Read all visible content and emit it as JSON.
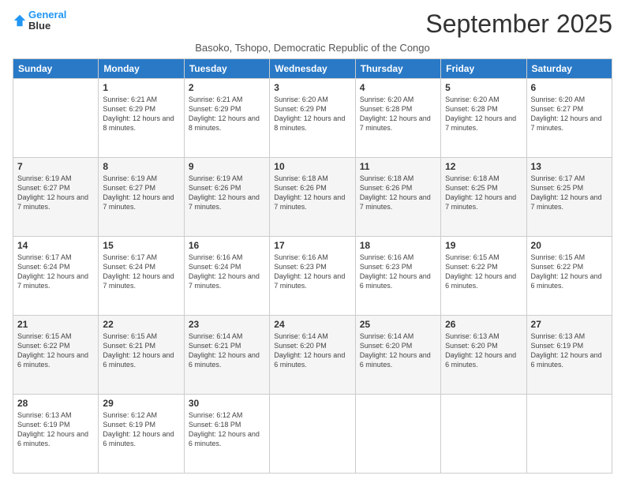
{
  "logo": {
    "line1": "General",
    "line2": "Blue"
  },
  "title": "September 2025",
  "subtitle": "Basoko, Tshopo, Democratic Republic of the Congo",
  "days_of_week": [
    "Sunday",
    "Monday",
    "Tuesday",
    "Wednesday",
    "Thursday",
    "Friday",
    "Saturday"
  ],
  "weeks": [
    [
      {
        "day": "",
        "info": ""
      },
      {
        "day": "1",
        "info": "Sunrise: 6:21 AM\nSunset: 6:29 PM\nDaylight: 12 hours\nand 8 minutes."
      },
      {
        "day": "2",
        "info": "Sunrise: 6:21 AM\nSunset: 6:29 PM\nDaylight: 12 hours\nand 8 minutes."
      },
      {
        "day": "3",
        "info": "Sunrise: 6:20 AM\nSunset: 6:29 PM\nDaylight: 12 hours\nand 8 minutes."
      },
      {
        "day": "4",
        "info": "Sunrise: 6:20 AM\nSunset: 6:28 PM\nDaylight: 12 hours\nand 7 minutes."
      },
      {
        "day": "5",
        "info": "Sunrise: 6:20 AM\nSunset: 6:28 PM\nDaylight: 12 hours\nand 7 minutes."
      },
      {
        "day": "6",
        "info": "Sunrise: 6:20 AM\nSunset: 6:27 PM\nDaylight: 12 hours\nand 7 minutes."
      }
    ],
    [
      {
        "day": "7",
        "info": "Sunrise: 6:19 AM\nSunset: 6:27 PM\nDaylight: 12 hours\nand 7 minutes."
      },
      {
        "day": "8",
        "info": "Sunrise: 6:19 AM\nSunset: 6:27 PM\nDaylight: 12 hours\nand 7 minutes."
      },
      {
        "day": "9",
        "info": "Sunrise: 6:19 AM\nSunset: 6:26 PM\nDaylight: 12 hours\nand 7 minutes."
      },
      {
        "day": "10",
        "info": "Sunrise: 6:18 AM\nSunset: 6:26 PM\nDaylight: 12 hours\nand 7 minutes."
      },
      {
        "day": "11",
        "info": "Sunrise: 6:18 AM\nSunset: 6:26 PM\nDaylight: 12 hours\nand 7 minutes."
      },
      {
        "day": "12",
        "info": "Sunrise: 6:18 AM\nSunset: 6:25 PM\nDaylight: 12 hours\nand 7 minutes."
      },
      {
        "day": "13",
        "info": "Sunrise: 6:17 AM\nSunset: 6:25 PM\nDaylight: 12 hours\nand 7 minutes."
      }
    ],
    [
      {
        "day": "14",
        "info": "Sunrise: 6:17 AM\nSunset: 6:24 PM\nDaylight: 12 hours\nand 7 minutes."
      },
      {
        "day": "15",
        "info": "Sunrise: 6:17 AM\nSunset: 6:24 PM\nDaylight: 12 hours\nand 7 minutes."
      },
      {
        "day": "16",
        "info": "Sunrise: 6:16 AM\nSunset: 6:24 PM\nDaylight: 12 hours\nand 7 minutes."
      },
      {
        "day": "17",
        "info": "Sunrise: 6:16 AM\nSunset: 6:23 PM\nDaylight: 12 hours\nand 7 minutes."
      },
      {
        "day": "18",
        "info": "Sunrise: 6:16 AM\nSunset: 6:23 PM\nDaylight: 12 hours\nand 6 minutes."
      },
      {
        "day": "19",
        "info": "Sunrise: 6:15 AM\nSunset: 6:22 PM\nDaylight: 12 hours\nand 6 minutes."
      },
      {
        "day": "20",
        "info": "Sunrise: 6:15 AM\nSunset: 6:22 PM\nDaylight: 12 hours\nand 6 minutes."
      }
    ],
    [
      {
        "day": "21",
        "info": "Sunrise: 6:15 AM\nSunset: 6:22 PM\nDaylight: 12 hours\nand 6 minutes."
      },
      {
        "day": "22",
        "info": "Sunrise: 6:15 AM\nSunset: 6:21 PM\nDaylight: 12 hours\nand 6 minutes."
      },
      {
        "day": "23",
        "info": "Sunrise: 6:14 AM\nSunset: 6:21 PM\nDaylight: 12 hours\nand 6 minutes."
      },
      {
        "day": "24",
        "info": "Sunrise: 6:14 AM\nSunset: 6:20 PM\nDaylight: 12 hours\nand 6 minutes."
      },
      {
        "day": "25",
        "info": "Sunrise: 6:14 AM\nSunset: 6:20 PM\nDaylight: 12 hours\nand 6 minutes."
      },
      {
        "day": "26",
        "info": "Sunrise: 6:13 AM\nSunset: 6:20 PM\nDaylight: 12 hours\nand 6 minutes."
      },
      {
        "day": "27",
        "info": "Sunrise: 6:13 AM\nSunset: 6:19 PM\nDaylight: 12 hours\nand 6 minutes."
      }
    ],
    [
      {
        "day": "28",
        "info": "Sunrise: 6:13 AM\nSunset: 6:19 PM\nDaylight: 12 hours\nand 6 minutes."
      },
      {
        "day": "29",
        "info": "Sunrise: 6:12 AM\nSunset: 6:19 PM\nDaylight: 12 hours\nand 6 minutes."
      },
      {
        "day": "30",
        "info": "Sunrise: 6:12 AM\nSunset: 6:18 PM\nDaylight: 12 hours\nand 6 minutes."
      },
      {
        "day": "",
        "info": ""
      },
      {
        "day": "",
        "info": ""
      },
      {
        "day": "",
        "info": ""
      },
      {
        "day": "",
        "info": ""
      }
    ]
  ]
}
